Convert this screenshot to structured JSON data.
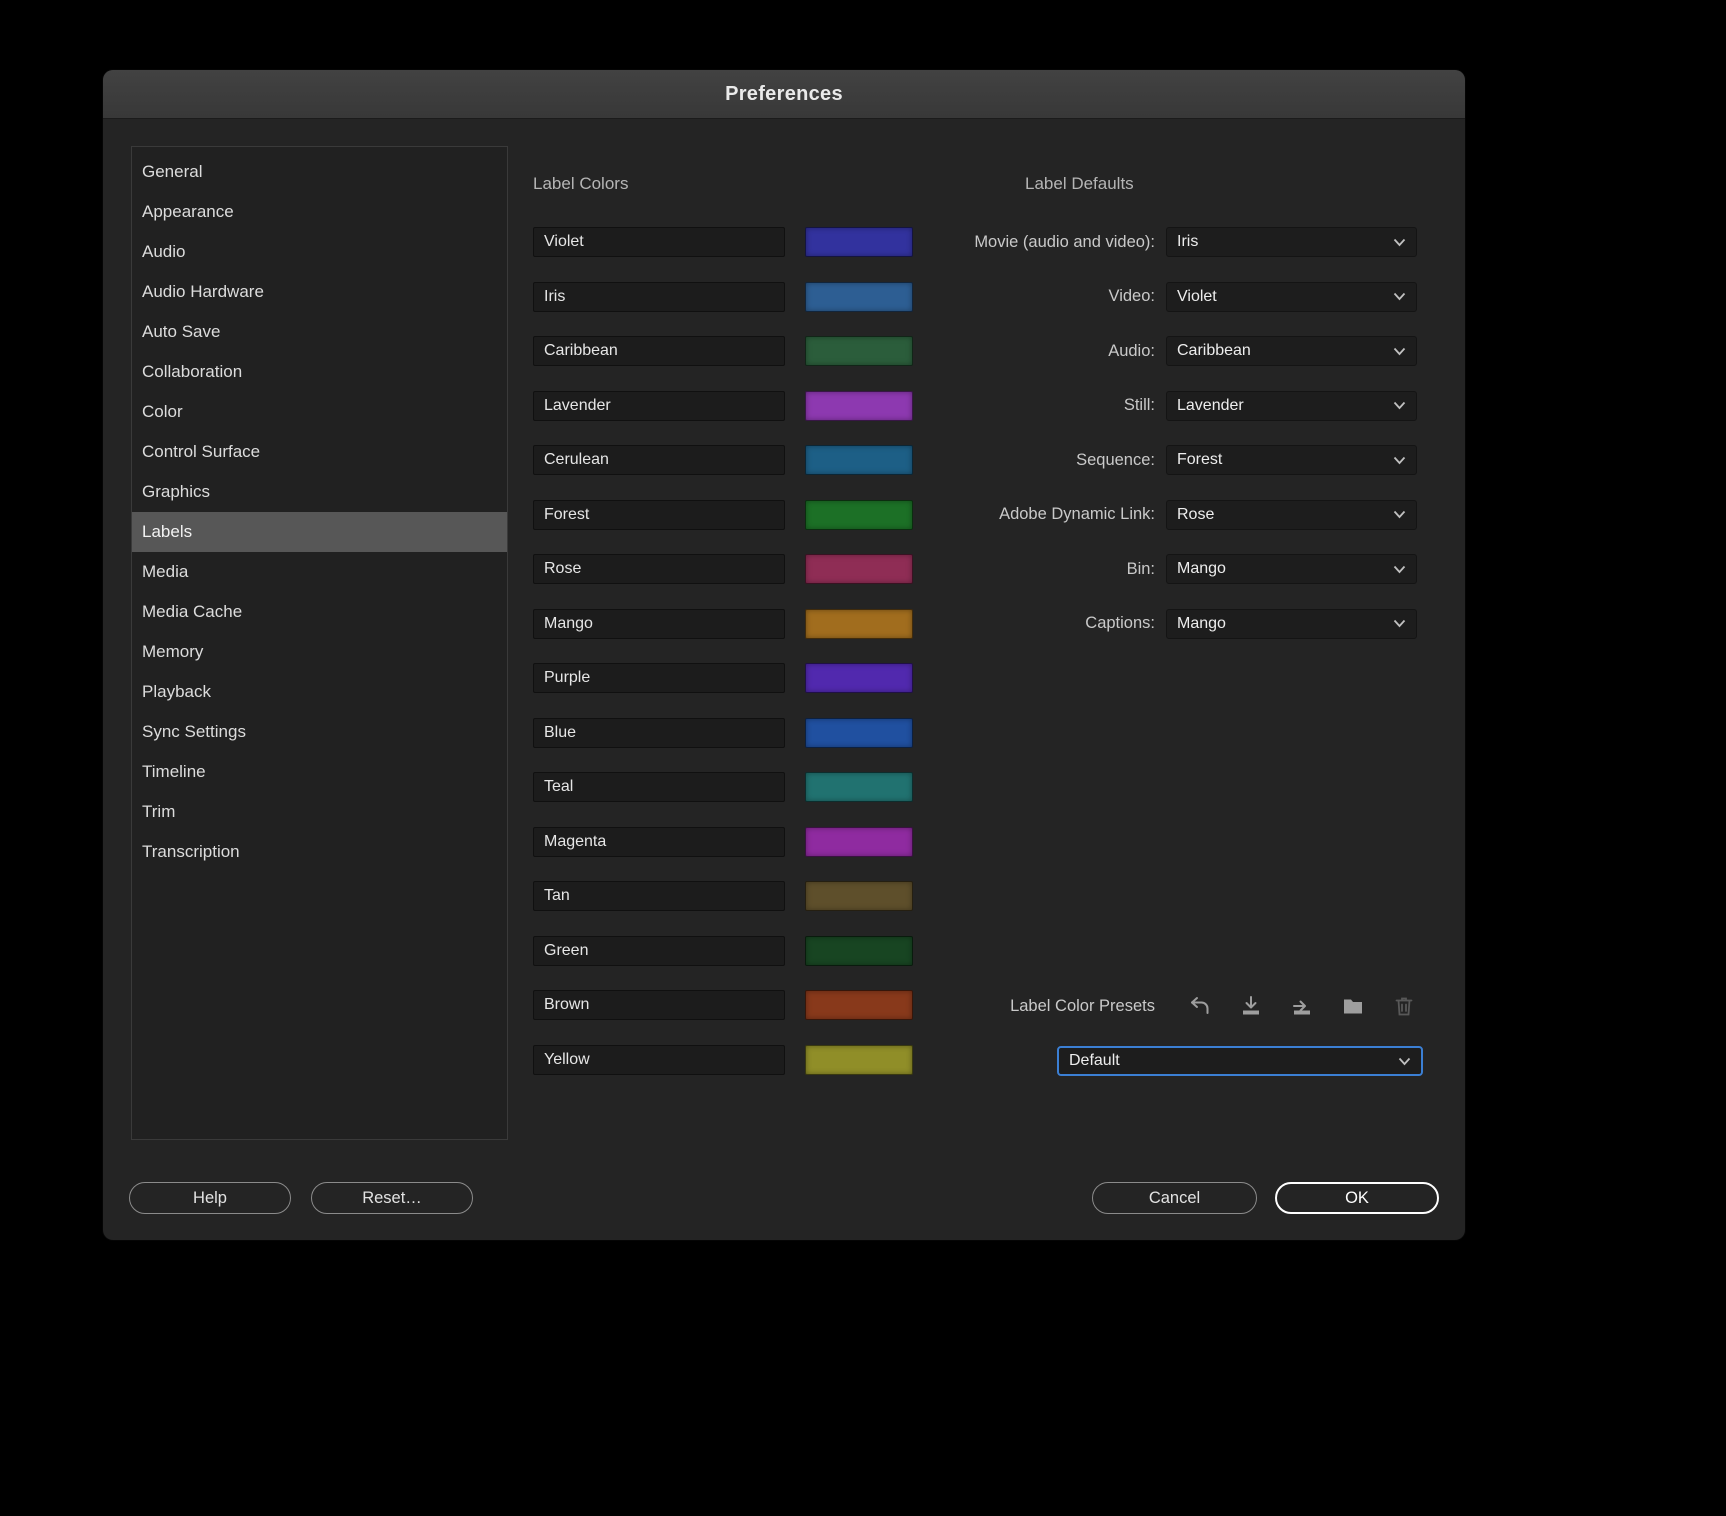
{
  "dialog": {
    "title": "Preferences"
  },
  "sidebar": {
    "items": [
      {
        "label": "General"
      },
      {
        "label": "Appearance"
      },
      {
        "label": "Audio"
      },
      {
        "label": "Audio Hardware"
      },
      {
        "label": "Auto Save"
      },
      {
        "label": "Collaboration"
      },
      {
        "label": "Color"
      },
      {
        "label": "Control Surface"
      },
      {
        "label": "Graphics"
      },
      {
        "label": "Labels",
        "selected": true
      },
      {
        "label": "Media"
      },
      {
        "label": "Media Cache"
      },
      {
        "label": "Memory"
      },
      {
        "label": "Playback"
      },
      {
        "label": "Sync Settings"
      },
      {
        "label": "Timeline"
      },
      {
        "label": "Trim"
      },
      {
        "label": "Transcription"
      }
    ]
  },
  "label_colors": {
    "heading": "Label Colors",
    "rows": [
      {
        "name": "Violet",
        "color": "#32329e"
      },
      {
        "name": "Iris",
        "color": "#2d5e93"
      },
      {
        "name": "Caribbean",
        "color": "#2b5d3b"
      },
      {
        "name": "Lavender",
        "color": "#8d39b0"
      },
      {
        "name": "Cerulean",
        "color": "#1d5f86"
      },
      {
        "name": "Forest",
        "color": "#1c7026"
      },
      {
        "name": "Rose",
        "color": "#8f2d55"
      },
      {
        "name": "Mango",
        "color": "#a16d1e"
      },
      {
        "name": "Purple",
        "color": "#5129ae"
      },
      {
        "name": "Blue",
        "color": "#2050a0"
      },
      {
        "name": "Teal",
        "color": "#217270"
      },
      {
        "name": "Magenta",
        "color": "#8f2ba0"
      },
      {
        "name": "Tan",
        "color": "#5e4f2b"
      },
      {
        "name": "Green",
        "color": "#184522"
      },
      {
        "name": "Brown",
        "color": "#88391b"
      },
      {
        "name": "Yellow",
        "color": "#908e28"
      }
    ]
  },
  "label_defaults": {
    "heading": "Label Defaults",
    "rows": [
      {
        "label": "Movie (audio and video):",
        "value": "Iris"
      },
      {
        "label": "Video:",
        "value": "Violet"
      },
      {
        "label": "Audio:",
        "value": "Caribbean"
      },
      {
        "label": "Still:",
        "value": "Lavender"
      },
      {
        "label": "Sequence:",
        "value": "Forest"
      },
      {
        "label": "Adobe Dynamic Link:",
        "value": "Rose"
      },
      {
        "label": "Bin:",
        "value": "Mango"
      },
      {
        "label": "Captions:",
        "value": "Mango"
      }
    ]
  },
  "presets": {
    "label": "Label Color Presets",
    "selected": "Default",
    "icons": [
      "undo-icon",
      "save-preset-icon",
      "save-as-preset-icon",
      "folder-icon",
      "trash-icon"
    ]
  },
  "footer": {
    "help": "Help",
    "reset": "Reset…",
    "cancel": "Cancel",
    "ok": "OK"
  }
}
